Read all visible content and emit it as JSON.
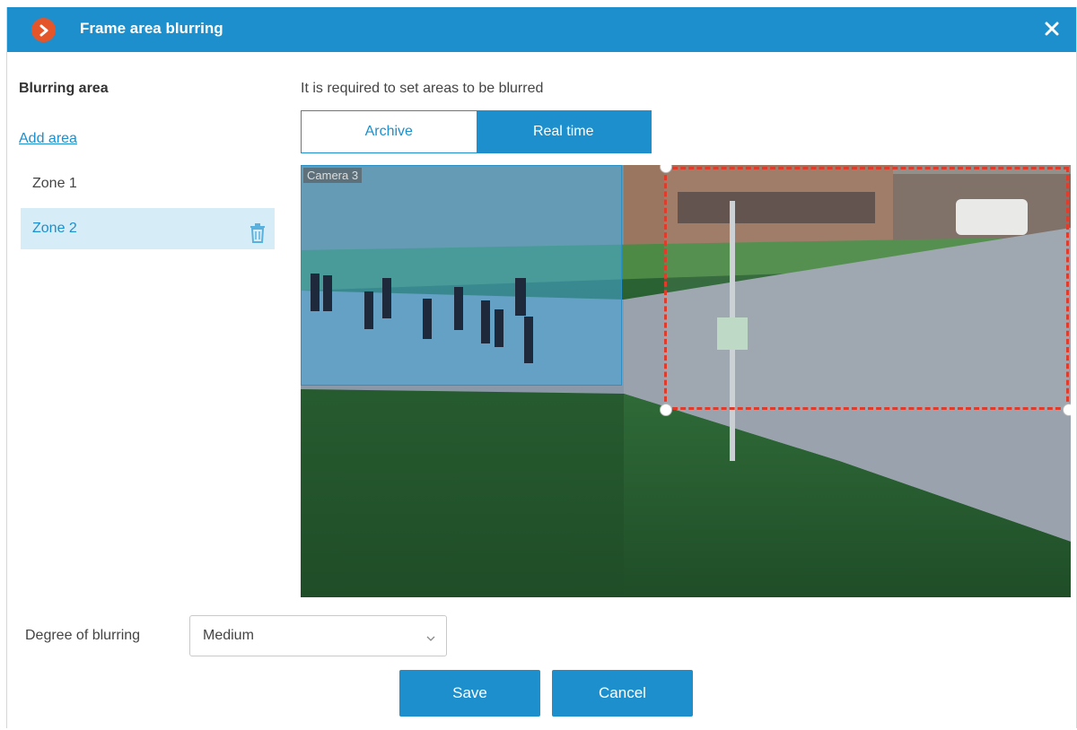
{
  "window": {
    "title": "Frame area blurring",
    "logo_icon": "chevron-right-icon",
    "close_icon": "close-icon",
    "accent_color": "#1c8fcc",
    "logo_color": "#e4552a"
  },
  "sidebar": {
    "heading": "Blurring area",
    "add_area_label": "Add area",
    "zones": [
      {
        "label": "Zone 1",
        "selected": false
      },
      {
        "label": "Zone 2",
        "selected": true,
        "action_icon": "trash-icon"
      }
    ]
  },
  "main": {
    "hint": "It is required to set areas to be blurred",
    "modes": [
      {
        "label": "Archive",
        "active": false
      },
      {
        "label": "Real time",
        "active": true
      }
    ],
    "camera_label": "Camera 3",
    "zone_outline_color": "#e03b2b"
  },
  "settings": {
    "degree_label": "Degree of blurring",
    "degree_value": "Medium"
  },
  "buttons": {
    "save": "Save",
    "cancel": "Cancel"
  }
}
